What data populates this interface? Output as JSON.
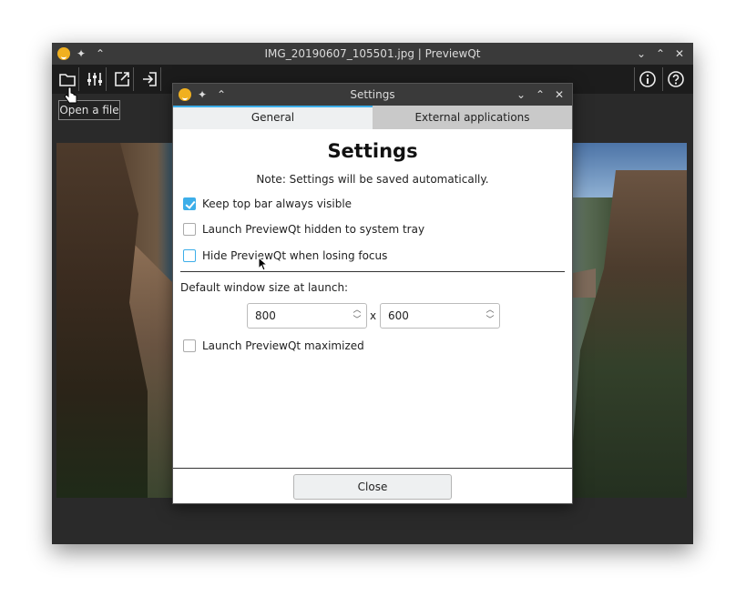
{
  "main_window": {
    "title": "IMG_20190607_105501.jpg | PreviewQt",
    "tooltip": "Open a file",
    "titlebar_buttons": [
      "chevron-down-icon",
      "chevron-up-icon",
      "close-icon"
    ],
    "toolbar_left": [
      "folder-icon",
      "sliders-icon",
      "open-external-icon",
      "login-icon"
    ],
    "toolbar_right": [
      "info-icon",
      "help-icon"
    ]
  },
  "settings": {
    "window_title": "Settings",
    "tabs": [
      {
        "label": "General",
        "active": true
      },
      {
        "label": "External applications",
        "active": false
      }
    ],
    "heading": "Settings",
    "note": "Note: Settings will be saved automatically.",
    "options": [
      {
        "label": "Keep top bar always visible",
        "checked": true
      },
      {
        "label": "Launch PreviewQt hidden to system tray",
        "checked": false
      },
      {
        "label": "Hide PreviewQt when losing focus",
        "checked": false
      }
    ],
    "window_size_label": "Default window size at launch:",
    "width_value": "800",
    "height_value": "600",
    "size_separator": "x",
    "maximized_label": "Launch PreviewQt maximized",
    "maximized_checked": false,
    "close_label": "Close"
  },
  "colors": {
    "accent": "#3daee9",
    "titlebar": "#3a3a3a",
    "app_icon": "#f0b020"
  }
}
